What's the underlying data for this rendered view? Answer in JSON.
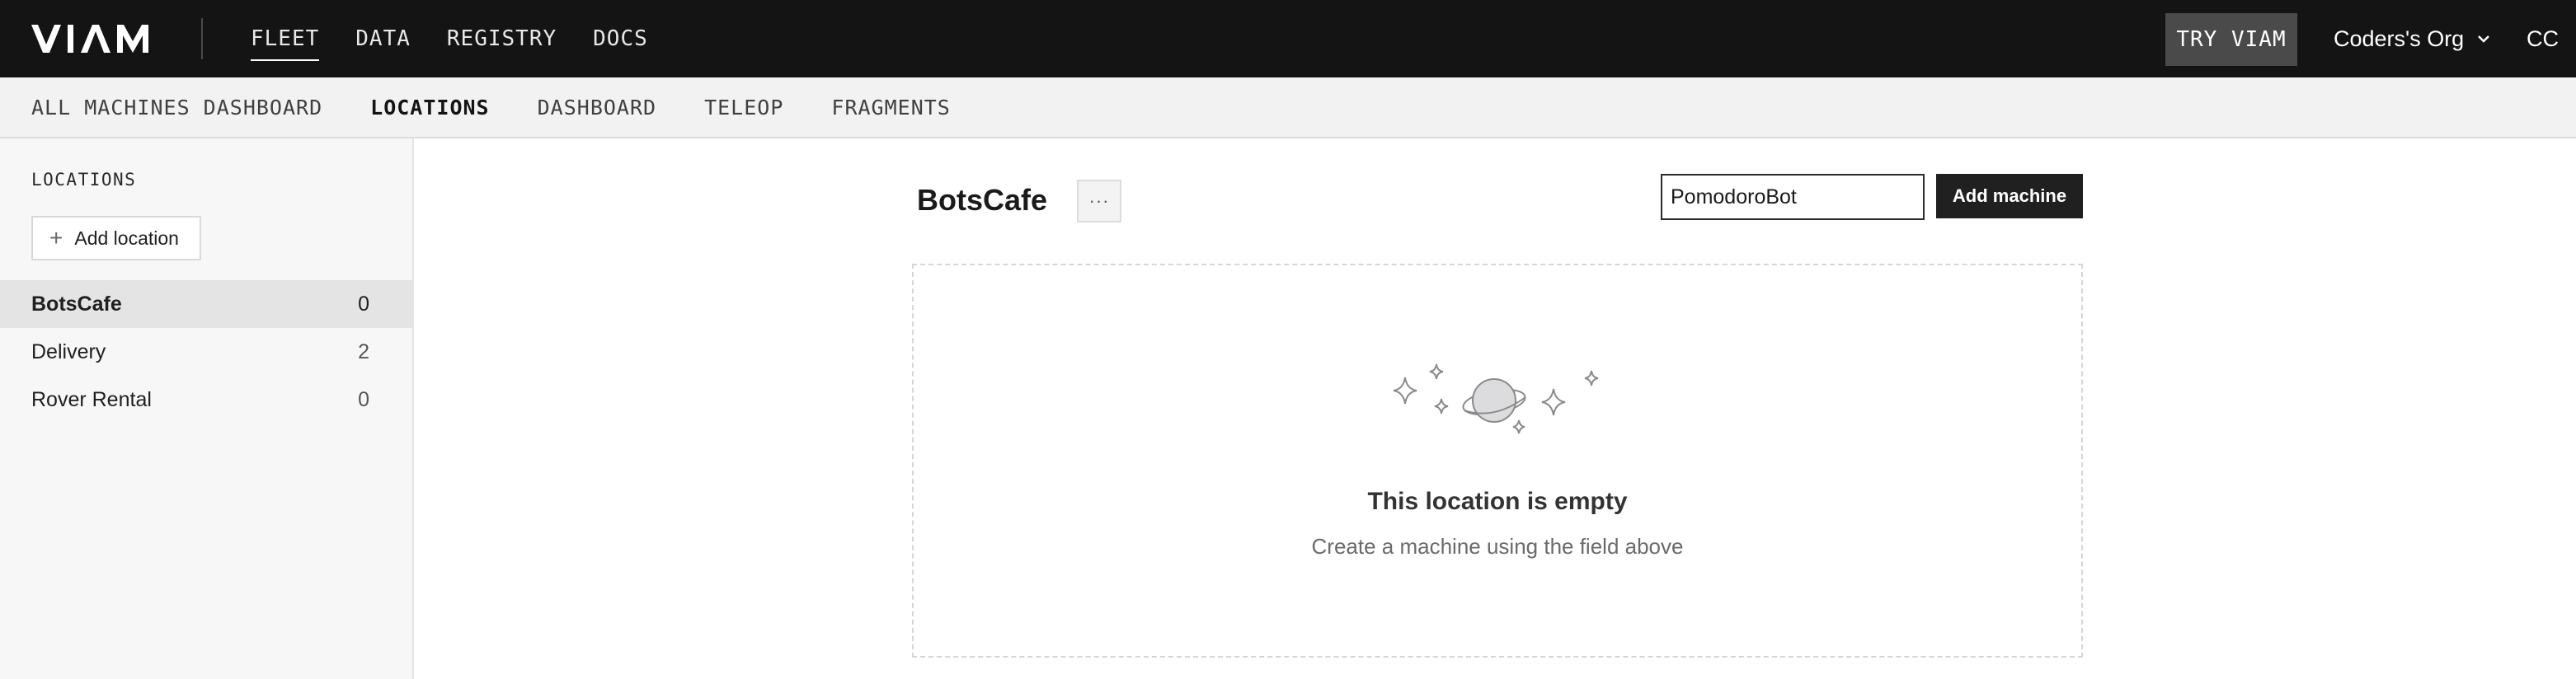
{
  "topnav": {
    "items": [
      {
        "label": "FLEET",
        "active": true
      },
      {
        "label": "DATA",
        "active": false
      },
      {
        "label": "REGISTRY",
        "active": false
      },
      {
        "label": "DOCS",
        "active": false
      }
    ],
    "try_label": "TRY VIAM",
    "org_name": "Coders's Org",
    "user_initials": "CC"
  },
  "subnav": {
    "items": [
      {
        "label": "ALL MACHINES DASHBOARD",
        "active": false
      },
      {
        "label": "LOCATIONS",
        "active": true
      },
      {
        "label": "DASHBOARD",
        "active": false
      },
      {
        "label": "TELEOP",
        "active": false
      },
      {
        "label": "FRAGMENTS",
        "active": false
      }
    ]
  },
  "sidebar": {
    "title": "LOCATIONS",
    "add_location_label": "Add location",
    "locations": [
      {
        "name": "BotsCafe",
        "count": "0",
        "active": true
      },
      {
        "name": "Delivery",
        "count": "2",
        "active": false
      },
      {
        "name": "Rover Rental",
        "count": "0",
        "active": false
      }
    ]
  },
  "main": {
    "location_name": "BotsCafe",
    "more_label": "···",
    "machine_input_value": "PomodoroBot",
    "add_machine_label": "Add machine",
    "empty_title": "This location is empty",
    "empty_subtitle": "Create a machine using the field above"
  },
  "colors": {
    "topbar_bg": "#141414",
    "subbar_bg": "#f2f2f3",
    "sidebar_bg": "#f7f7f8",
    "active_location_bg": "#e4e4e5",
    "primary_button": "#202020"
  },
  "icons": [
    "viam-logo",
    "chevron-down-icon",
    "plus-icon",
    "more-icon",
    "planet-illustration",
    "sparkle-icon"
  ]
}
